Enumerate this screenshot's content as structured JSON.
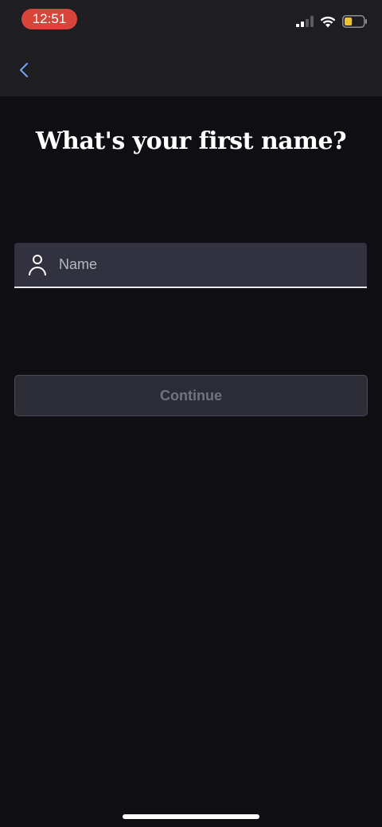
{
  "status_bar": {
    "time": "12:51",
    "time_pill_color": "#d9443a",
    "battery_level": 0.4,
    "battery_color": "#f2c230"
  },
  "nav": {
    "back_icon": "chevron-left-icon",
    "accent": "#6f9ef0"
  },
  "page": {
    "title": "What's your first name?"
  },
  "name_field": {
    "placeholder": "Name",
    "value": "",
    "icon": "person-icon"
  },
  "continue_button": {
    "label": "Continue",
    "enabled": false
  }
}
